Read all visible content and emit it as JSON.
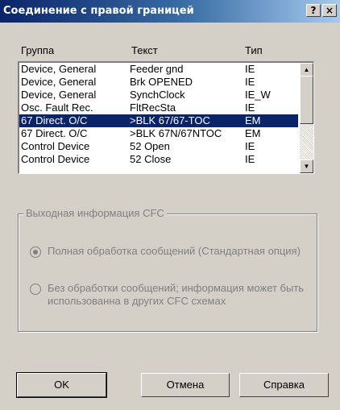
{
  "window": {
    "title": "Соединение с правой границей",
    "help_label": "?",
    "close_label": "×"
  },
  "list": {
    "headers": [
      "Группа",
      "Текст",
      "Тип"
    ],
    "rows": [
      {
        "group": "Device, General",
        "text": "Feeder gnd",
        "type": "IE"
      },
      {
        "group": "Device, General",
        "text": "Brk OPENED",
        "type": "IE"
      },
      {
        "group": "Device, General",
        "text": "SynchClock",
        "type": "IE_W"
      },
      {
        "group": "Osc. Fault Rec.",
        "text": "FltRecSta",
        "type": "IE"
      },
      {
        "group": "67 Direct. O/C",
        "text": ">BLK 67/67-TOC",
        "type": "EM"
      },
      {
        "group": "67 Direct. O/C",
        "text": ">BLK 67N/67NTOC",
        "type": "EM"
      },
      {
        "group": "Control Device",
        "text": "52 Open",
        "type": "IE"
      },
      {
        "group": "Control Device",
        "text": "52 Close",
        "type": "IE"
      }
    ],
    "selected_index": 4
  },
  "output_group": {
    "title": "Выходная информация CFC",
    "option1": "Полная обработка сообщений (Стандартная опция)",
    "option2": "Без обработки сообщений; информация может быть использованна в других CFC схемах",
    "selected_option": 1
  },
  "buttons": {
    "ok": "OK",
    "cancel": "Отмена",
    "help": "Справка"
  }
}
